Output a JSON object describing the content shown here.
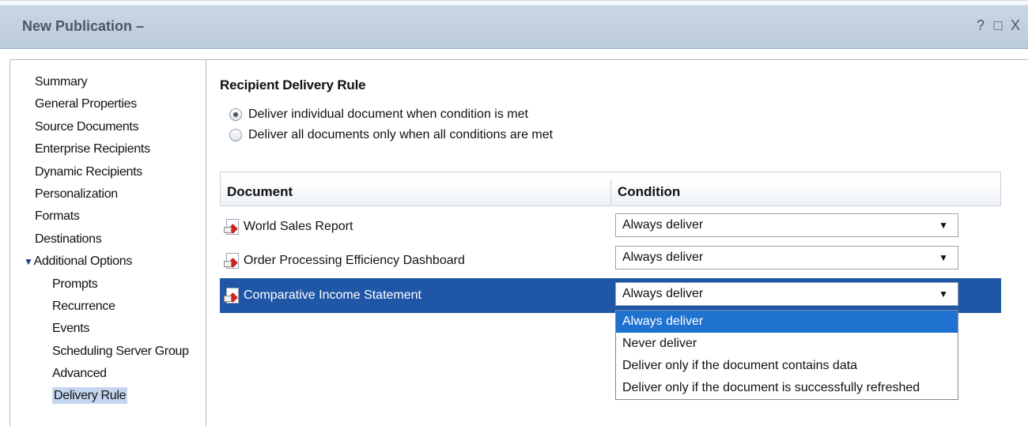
{
  "window": {
    "title": "New Publication –",
    "help_icon": "?",
    "maximize_icon": "□",
    "close_icon": "X"
  },
  "sidebar": {
    "items": [
      {
        "label": "Summary"
      },
      {
        "label": "General Properties"
      },
      {
        "label": "Source Documents"
      },
      {
        "label": "Enterprise Recipients"
      },
      {
        "label": "Dynamic Recipients"
      },
      {
        "label": "Personalization"
      },
      {
        "label": "Formats"
      },
      {
        "label": "Destinations"
      },
      {
        "label": "Additional Options",
        "expanded_marker": "▼"
      },
      {
        "label": "Prompts"
      },
      {
        "label": "Recurrence"
      },
      {
        "label": "Events"
      },
      {
        "label": "Scheduling Server Group"
      },
      {
        "label": "Advanced"
      },
      {
        "label": "Delivery Rule",
        "selected": true
      }
    ]
  },
  "main": {
    "section_title": "Recipient Delivery Rule",
    "radios": [
      {
        "label": "Deliver individual document when condition is met",
        "checked": true
      },
      {
        "label": "Deliver all documents only when all conditions are met",
        "checked": false
      }
    ],
    "grid": {
      "headers": {
        "document": "Document",
        "condition": "Condition"
      },
      "rows": [
        {
          "document": "World Sales Report",
          "condition": "Always deliver",
          "selected": false
        },
        {
          "document": "Order Processing Efficiency Dashboard",
          "condition": "Always deliver",
          "selected": false
        },
        {
          "document": "Comparative Income Statement",
          "condition": "Always deliver",
          "selected": true
        }
      ],
      "caret": "▼"
    },
    "dropdown_options": [
      "Always deliver",
      "Never deliver",
      "Deliver only if the document contains data",
      "Deliver only if the document is successfully refreshed"
    ],
    "dropdown_active": "Always deliver"
  },
  "colors": {
    "selected_row": "#1f56a6",
    "dropdown_active": "#1f72d0",
    "nav_selected": "#c4d6ef"
  }
}
